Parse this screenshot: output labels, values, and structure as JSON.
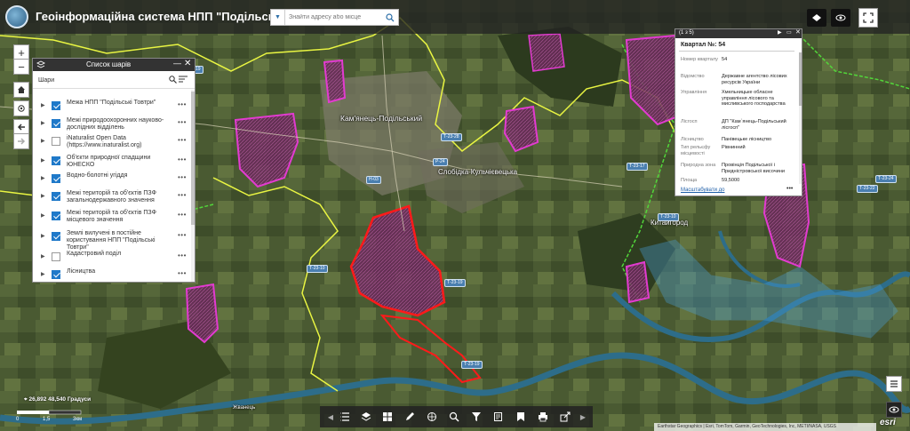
{
  "header": {
    "title": "Геоінформаційна система НПП \"Подільські Товтри\"",
    "search_placeholder": "Знайти адресу або місце"
  },
  "map_labels": {
    "kamianets": "Кам'янець-Подільський",
    "slobidka": "Слобідка-Кульчієвецька",
    "kytaihorod": "Китайгород",
    "zhvanets": "Жванець",
    "roads": [
      "Т-23-19",
      "Н-03",
      "Т-23-28",
      "Р-24",
      "Т-23-17",
      "Т-23-10",
      "Т-23-19",
      "Т-23-19",
      "Т-23-22",
      "Т-23-24",
      "Т-23-10"
    ]
  },
  "layer_panel": {
    "title": "Список шарів",
    "subtitle": "Шари",
    "layers": [
      {
        "label": "Межа НПП \"Подільські Товтри\"",
        "checked": true
      },
      {
        "label": "Межі природоохоронних науково-дослідних відділень",
        "checked": true
      },
      {
        "label": "iNaturalist Open Data (https://www.inaturalist.org)",
        "checked": false
      },
      {
        "label": "Об'єкти природної спадщини ЮНЕСКО",
        "checked": true
      },
      {
        "label": "Водно-болотні угіддя",
        "checked": true
      },
      {
        "label": "Межі територій та об'єктів ПЗФ загальнодержавного значення",
        "checked": true
      },
      {
        "label": "Межі територій та об'єктів ПЗФ місцевого значення",
        "checked": true
      },
      {
        "label": "Землі вилучені в постійне користування НПП \"Подільські Товтри\"",
        "checked": true
      },
      {
        "label": "Кадастровий поділ",
        "checked": false
      },
      {
        "label": "Лісництва",
        "checked": true
      }
    ]
  },
  "popup": {
    "count": "(1 з 5)",
    "title": "Квартал №: 54",
    "fields": [
      {
        "key": "Номер кварталу",
        "value": "54"
      },
      {
        "key": "Відомство",
        "value": "Державне агентство лісових ресурсів України"
      },
      {
        "key": "Управління",
        "value": "Хмельницьке обласне управління лісового та мисливського господарства"
      },
      {
        "key": "Лісгосп",
        "value": "ДП \"Кам`янець-Подільський лісгосп\""
      },
      {
        "key": "Лісництво",
        "value": "Панівецьке лісництво"
      },
      {
        "key": "Тип рельєфу місцевості",
        "value": "Рівнинний"
      },
      {
        "key": "Природна зона",
        "value": "Провінція Подільської і Придністровської височини"
      },
      {
        "key": "Площа",
        "value": "59,5000"
      }
    ],
    "zoom_link": "Масштабувати до"
  },
  "status": {
    "coordinates": "26,892 48,540 Градуси",
    "scale_labels": [
      "0",
      "1,5",
      "3км"
    ],
    "attribution": "Earthstar Geographics | Esri, TomTom, Garmin, GeoTechnologies, Inc, METI/NASA, USGS",
    "esri": "esri"
  },
  "icons": {
    "zoom_in": "plus-icon",
    "zoom_out": "minus-icon",
    "home": "home-icon",
    "locate": "locate-icon",
    "back": "arrow-left-icon",
    "forward": "arrow-right-icon"
  },
  "colors": {
    "park_boundary": "#e9f542",
    "forest_quarters": "#e23bd0",
    "protected_national": "#ff1a1a",
    "wetland": "#4aa3df",
    "river": "#2d6d8a"
  }
}
